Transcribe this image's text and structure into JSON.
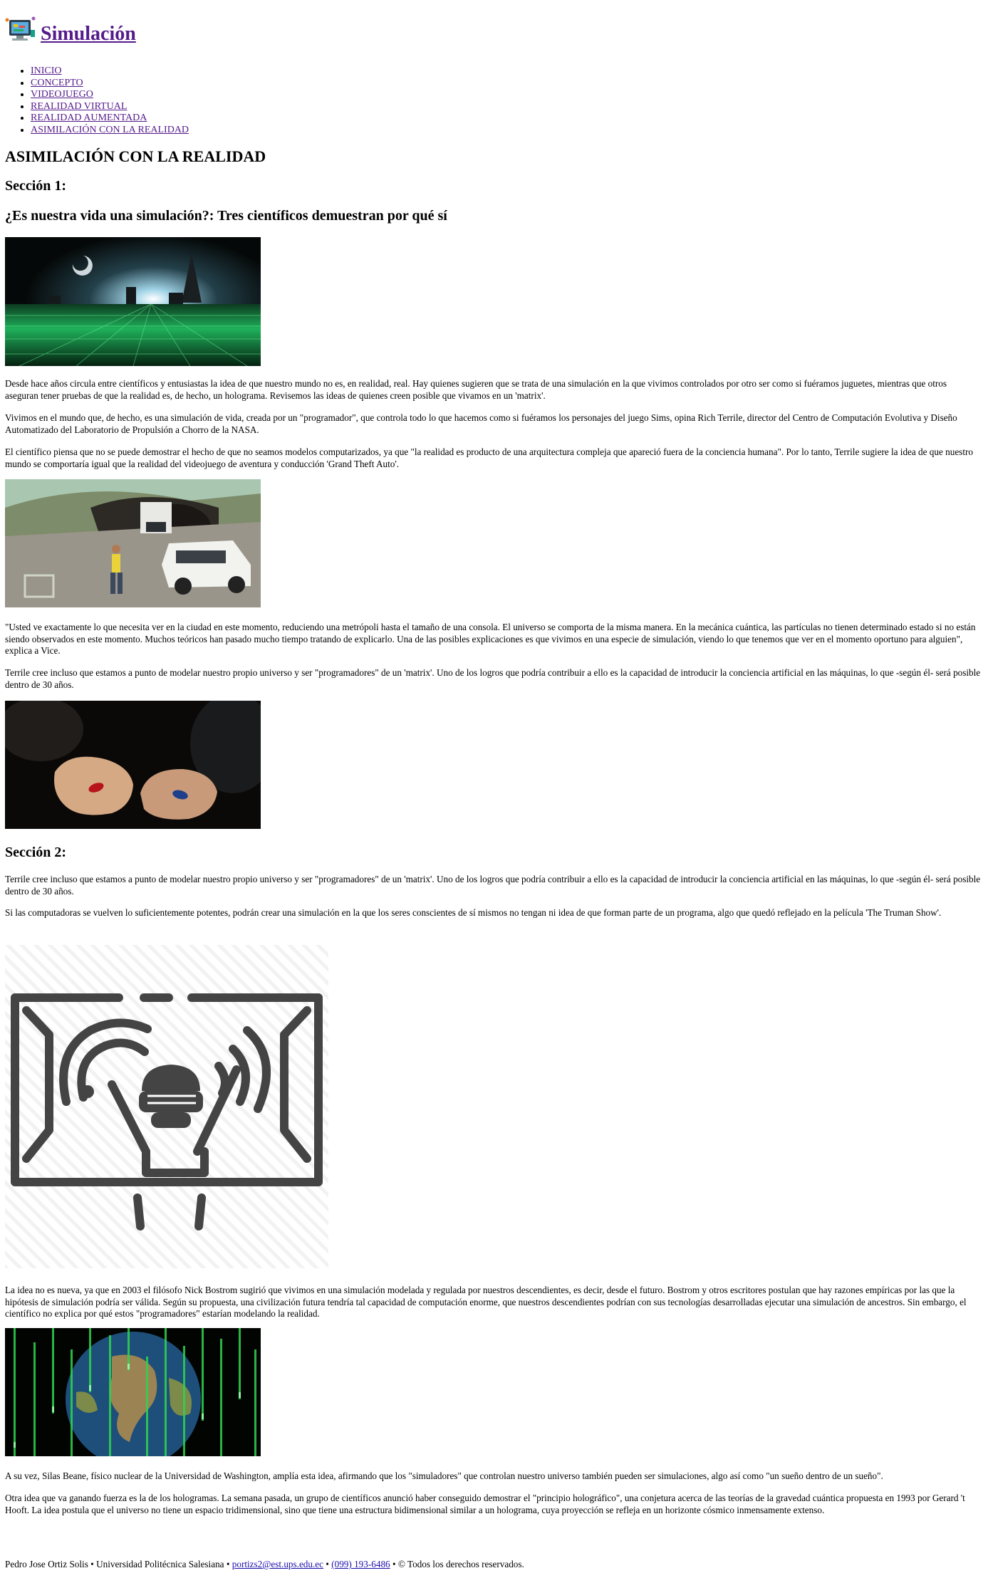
{
  "header": {
    "site_title": "Simulación"
  },
  "nav": {
    "items": [
      {
        "label": "INICIO"
      },
      {
        "label": "CONCEPTO"
      },
      {
        "label": "VIDEOJUEGO"
      },
      {
        "label": "REALIDAD VIRTUAL"
      },
      {
        "label": "REALIDAD AUMENTADA"
      },
      {
        "label": "ASIMILACIÓN CON LA REALIDAD"
      }
    ]
  },
  "page": {
    "title": "ASIMILACIÓN CON LA REALIDAD"
  },
  "section1": {
    "heading": "Sección 1:",
    "subheading": "¿Es nuestra vida una simulación?: Tres científicos demuestran por qué sí",
    "p1": "Desde hace años circula entre científicos y entusiastas la idea de que nuestro mundo no es, en realidad, real. Hay quienes sugieren que se trata de una simulación en la que vivimos controlados por otro ser como si fuéramos juguetes, mientras que otros aseguran tener pruebas de que la realidad es, de hecho, un holograma. Revisemos las ideas de quienes creen posible que vivamos en un 'matrix'.",
    "p2": "Vivimos en el mundo que, de hecho, es una simulación de vida, creada por un \"programador\", que controla todo lo que hacemos como si fuéramos los personajes del juego Sims, opina Rich Terrile, director del Centro de Computación Evolutiva y Diseño Automatizado del Laboratorio de Propulsión a Chorro de la NASA.",
    "p3": "El científico piensa que no se puede demostrar el hecho de que no seamos modelos computarizados, ya que \"la realidad es producto de una arquitectura compleja que apareció fuera de la conciencia humana\". Por lo tanto, Terrile sugiere la idea de que nuestro mundo se comportaría igual que la realidad del videojuego de aventura y conducción 'Grand Theft Auto'.",
    "p4": "\"Usted ve exactamente lo que necesita ver en la ciudad en este momento, reduciendo una metrópoli hasta el tamaño de una consola. El universo se comporta de la misma manera. En la mecánica cuántica, las partículas no tienen determinado estado si no están siendo observados en este momento. Muchos teóricos han pasado mucho tiempo tratando de explicarlo. Una de las posibles explicaciones es que vivimos en una especie de simulación, viendo lo que tenemos que ver en el momento oportuno para alguien\", explica a Vice.",
    "p5": "Terrile cree incluso que estamos a punto de modelar nuestro propio universo y ser \"programadores\" de un 'matrix'. Uno de los logros que podría contribuir a ello es la capacidad de introducir la conciencia artificial en las máquinas, lo que -según él- será posible dentro de 30 años."
  },
  "section2": {
    "heading": "Sección 2:",
    "p1": "Terrile cree incluso que estamos a punto de modelar nuestro propio universo y ser \"programadores\" de un 'matrix'. Uno de los logros que podría contribuir a ello es la capacidad de introducir la conciencia artificial en las máquinas, lo que -según él- será posible dentro de 30 años.",
    "p2": "Si las computadoras se vuelven lo suficientemente potentes, podrán crear una simulación en la que los seres conscientes de sí mismos no tengan ni idea de que forman parte de un programa, algo que quedó reflejado en la película 'The Truman Show'.",
    "p3": "La idea no es nueva, ya que en 2003 el filósofo Nick Bostrom sugirió que vivimos en una simulación modelada y regulada por nuestros descendientes, es decir, desde el futuro. Bostrom y otros escritores postulan que hay razones empíricas por las que la hipótesis de simulación podría ser válida. Según su propuesta, una civilización futura tendría tal capacidad de computación enorme, que nuestros descendientes podrían con sus tecnologías desarrolladas ejecutar una simulación de ancestros. Sin embargo, el científico no explica por qué estos \"programadores\" estarían modelando la realidad.",
    "p4": "A su vez, Silas Beane, físico nuclear de la Universidad de Washington, amplía esta idea, afirmando que los \"simuladores\" que controlan nuestro universo también pueden ser simulaciones, algo así como \"un sueño dentro de un sueño\".",
    "p5": "Otra idea que va ganando fuerza es la de los hologramas. La semana pasada, un grupo de científicos anunció haber conseguido demostrar el \"principio holográfico\", una conjetura acerca de las teorías de la gravedad cuántica propuesta en 1993 por Gerard 't Hooft. La idea postula que el universo no tiene un espacio tridimensional, sino que tiene una estructura bidimensional similar a un holograma, cuya proyección se refleja en un horizonte cósmico inmensamente extenso."
  },
  "footer": {
    "author": "Pedro Jose Ortiz Solis",
    "sep1": " • ",
    "university": "Universidad Politécnica Salesiana",
    "sep2": " • ",
    "email": "portizs2@est.ups.edu.ec",
    "sep3": " • ",
    "phone": "(099) 193-6486",
    "sep4": " • ",
    "copyright": "© Todos los derechos reservados."
  }
}
